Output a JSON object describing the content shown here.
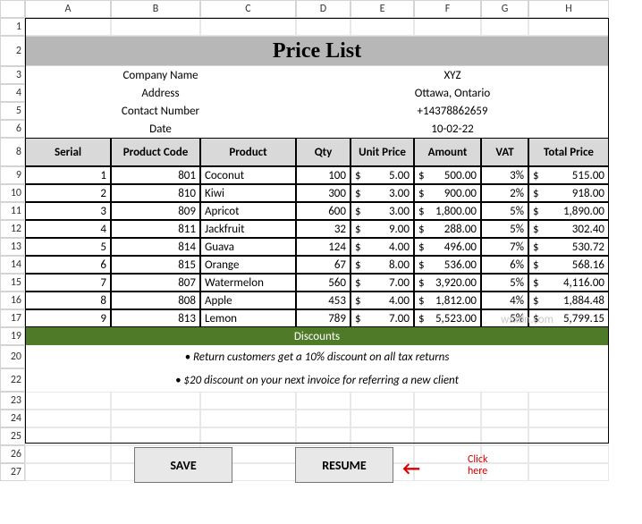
{
  "columns": [
    "A",
    "B",
    "C",
    "D",
    "E",
    "F",
    "G",
    "H"
  ],
  "rows": [
    "1",
    "2",
    "3",
    "4",
    "5",
    "6",
    "8",
    "9",
    "10",
    "11",
    "12",
    "13",
    "14",
    "15",
    "16",
    "17",
    "19",
    "20",
    "22",
    "23",
    "24",
    "25",
    "26",
    "27"
  ],
  "title": "Price List",
  "info": {
    "labels": [
      "Company Name",
      "Address",
      "Contact Number",
      "Date"
    ],
    "values": [
      "XYZ",
      "Ottawa, Ontario",
      "+14378862659",
      "10-02-22"
    ]
  },
  "headers": [
    "Serial",
    "Product Code",
    "Product",
    "Qty",
    "Unit Price",
    "Amount",
    "VAT",
    "Total Price"
  ],
  "data": [
    {
      "serial": "1",
      "code": "801",
      "product": "Coconut",
      "qty": "100",
      "unit": "5.00",
      "amount": "500.00",
      "vat": "3%",
      "total": "515.00"
    },
    {
      "serial": "2",
      "code": "810",
      "product": "Kiwi",
      "qty": "300",
      "unit": "3.00",
      "amount": "900.00",
      "vat": "2%",
      "total": "918.00"
    },
    {
      "serial": "3",
      "code": "809",
      "product": "Apricot",
      "qty": "600",
      "unit": "3.00",
      "amount": "1,800.00",
      "vat": "5%",
      "total": "1,890.00"
    },
    {
      "serial": "4",
      "code": "811",
      "product": "Jackfruit",
      "qty": "32",
      "unit": "9.00",
      "amount": "288.00",
      "vat": "5%",
      "total": "302.40"
    },
    {
      "serial": "5",
      "code": "814",
      "product": "Guava",
      "qty": "124",
      "unit": "4.00",
      "amount": "496.00",
      "vat": "7%",
      "total": "530.72"
    },
    {
      "serial": "6",
      "code": "815",
      "product": "Orange",
      "qty": "67",
      "unit": "8.00",
      "amount": "536.00",
      "vat": "6%",
      "total": "568.16"
    },
    {
      "serial": "7",
      "code": "807",
      "product": "Watermelon",
      "qty": "560",
      "unit": "7.00",
      "amount": "3,920.00",
      "vat": "5%",
      "total": "4,116.00"
    },
    {
      "serial": "8",
      "code": "808",
      "product": "Apple",
      "qty": "453",
      "unit": "4.00",
      "amount": "1,812.00",
      "vat": "4%",
      "total": "1,884.48"
    },
    {
      "serial": "9",
      "code": "813",
      "product": "Lemon",
      "qty": "789",
      "unit": "7.00",
      "amount": "5,523.00",
      "vat": "5%",
      "total": "5,799.15"
    }
  ],
  "currency": "$",
  "discounts": {
    "heading": "Discounts",
    "lines": [
      "• Return customers get a 10% discount on all tax returns",
      "• $20 discount on your next invoice for referring a new client"
    ]
  },
  "buttons": {
    "save": "SAVE",
    "resume": "RESUME"
  },
  "annotation": "Click here",
  "watermark": "wsxdn.com"
}
